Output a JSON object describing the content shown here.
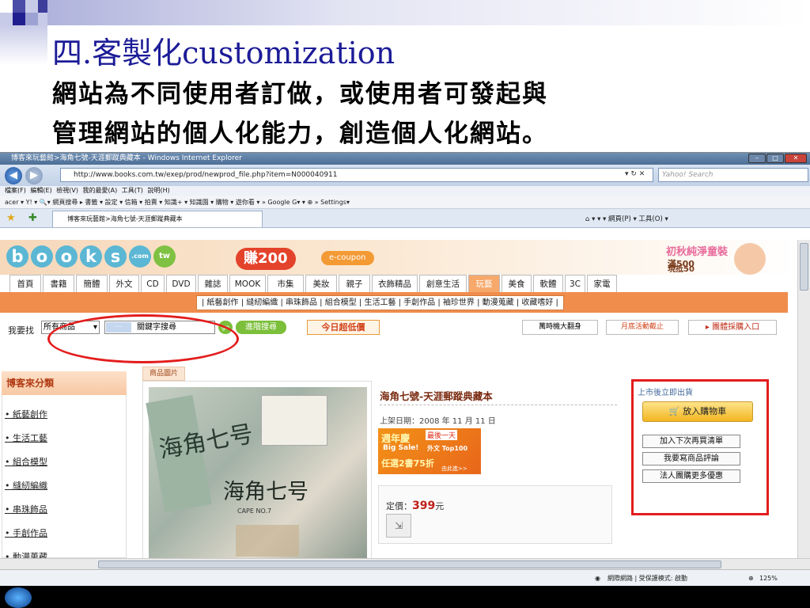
{
  "slide": {
    "title": "四.客製化customization",
    "line1": "網站為不同使用者訂做，或使用者可發起與",
    "line2": "管理網站的個人化能力，創造個人化網站。"
  },
  "window": {
    "title": "博客來玩藝館>海角七號-天涯郵蹤典藏本 - Windows Internet Explorer",
    "url": "http://www.books.com.tw/exep/prod/newprod_file.php?item=N000040911",
    "search_placeholder": "Yahoo! Search",
    "menu": [
      "檔案(F)",
      "編輯(E)",
      "檢視(V)",
      "我的最愛(A)",
      "工具(T)",
      "說明(H)"
    ],
    "toolbar_items": "acer ▾  Y! ▾                    🔍▾ 網頁搜尋 ▸ 書籤 ▾  設定 ▾  信箱 ▾  拍賣 ▾  知識+ ▾  知識園 ▾  購物 ▾  遊你看 ▾  »   Google  G▾   ▾   ⊕ »   Settings▾",
    "tab_title": "博客來玩藝館>海角七號-天涯郵蹤典藏本",
    "tools_right": "⌂ ▾   ▾   ▾  網頁(P) ▾   工具(O) ▾",
    "status_text": "網際網路 | 受保護模式: 啟動",
    "zoom": "125%"
  },
  "site": {
    "logo_letters": [
      "b",
      "o",
      "o",
      "k",
      "s",
      ".com",
      "tw"
    ],
    "coupon_amount": "賺200",
    "coupon_label": "e-coupon",
    "banner_right_line1": "初秋純淨童裝",
    "banner_right_line2": "滿500",
    "banner_right_line3": "現抵50",
    "nav_tabs": [
      "首頁",
      "書籍",
      "簡體",
      "外文",
      "CD",
      "DVD",
      "雜誌",
      "MOOK",
      "市集",
      "美妝",
      "親子",
      "衣飾精品",
      "創意生活",
      "玩藝",
      "美食",
      "軟體",
      "3C",
      "家電"
    ],
    "categories": "| 紙藝創作 | 縫紉編織 | 串珠飾品 | 組合模型 | 生活工藝 | 手創作品 | 袖珍世界 | 動漫蒐藏 | 收藏嗜好 |",
    "search_label": "我要找",
    "search_scope": "所有商品",
    "search_field_hint": "關鍵字搜尋",
    "go_label": "go",
    "advanced_search": "進階搜尋",
    "today_deal": "今日超低價",
    "promo1": "萬時機大翻身",
    "promo2": "月底活動截止",
    "group_buy": "▸ 團體採購入口",
    "sidebar_heading": "博客來分類",
    "sidebar_items": [
      "紙藝創作",
      "生活工藝",
      "組合模型",
      "縫紉編織",
      "串珠飾品",
      "手創作品",
      "動漫蒐藏"
    ],
    "image_tab": "商品圖片",
    "product_title": "海角七號-天涯郵蹤典藏本",
    "release_date": "上架日期：2008 年 11 月 11 日",
    "anniv_top": "週年慶",
    "anniv_slogan": "最後一天",
    "anniv_big": "Big Sale!",
    "anniv_foreign": "外文 Top100",
    "anniv_deal": "任選2書75折",
    "anniv_more": "由此進>>",
    "price_label": "定價：",
    "price_value": "399",
    "price_unit": "元",
    "stock_status": "上市後立即出貨",
    "add_to_cart": "放入購物車",
    "wishlist": "加入下次再買清單",
    "review": "我要寫商品評論",
    "corporate": "法人團購更多優惠",
    "cover_title_left": "海角七号",
    "cover_title": "海角七号",
    "cover_sub": "CAPE NO.7"
  }
}
